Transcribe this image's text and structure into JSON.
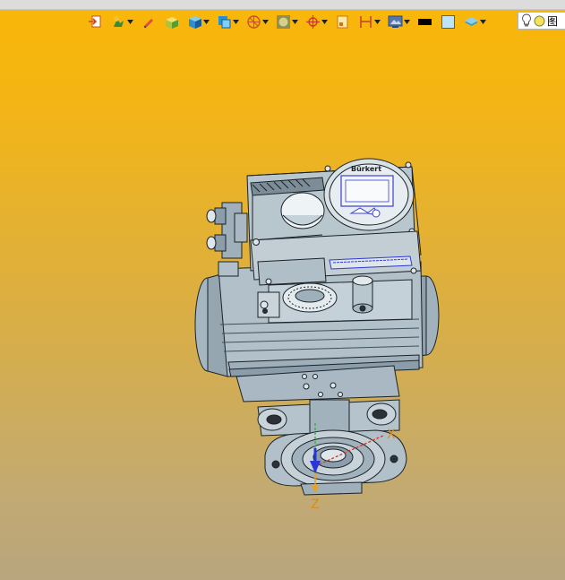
{
  "toolbar": {
    "buttons": [
      {
        "icon": "exit-view-icon"
      },
      {
        "icon": "zoom-render-icon",
        "dropdown": true
      },
      {
        "icon": "pencil-icon"
      },
      {
        "icon": "part-box-icon"
      },
      {
        "icon": "solid-cube-icon",
        "dropdown": true
      },
      {
        "icon": "view-orient-icon",
        "dropdown": true
      },
      {
        "icon": "section-view-icon",
        "dropdown": true
      },
      {
        "icon": "display-style-icon",
        "dropdown": true
      },
      {
        "icon": "origin-target-icon",
        "dropdown": true
      },
      {
        "icon": "sheet-icon"
      },
      {
        "icon": "dimension-icon",
        "dropdown": true
      },
      {
        "icon": "scene-settings-icon",
        "dropdown": true
      },
      {
        "icon": "black-color-icon"
      },
      {
        "icon": "background-color-icon"
      },
      {
        "icon": "layer-icon",
        "dropdown": true
      }
    ],
    "search_text": "图"
  },
  "axes": {
    "x": "X",
    "z": "Z"
  },
  "colors": {
    "background_top": "#fab708",
    "background_bottom": "#b9a57e",
    "model_fill": "#a9b8c2",
    "model_edge": "#1b2228",
    "axis_label": "#d98b1c"
  }
}
